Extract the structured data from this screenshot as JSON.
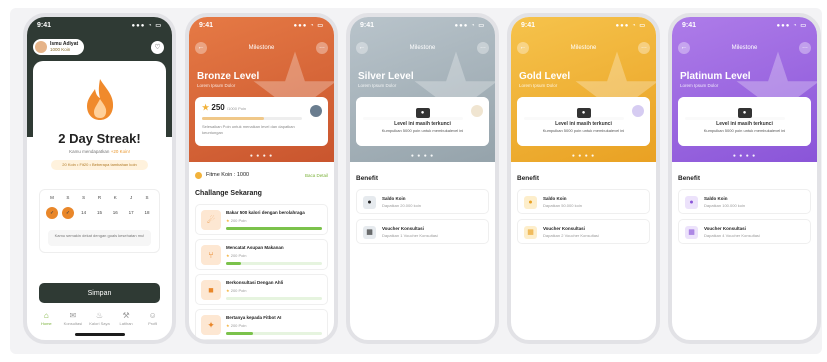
{
  "colors": {
    "bronze": "#d9653a",
    "silver": "#a8b5bd",
    "gold": "#f0b63a",
    "platinum": "#9a63e0",
    "green": "#7bb23a",
    "dark": "#2f3a34"
  },
  "status": {
    "time": "9:41",
    "signal": "●●● ◔ ▭"
  },
  "streak": {
    "user_name": "Ismu Adiyat",
    "user_coins": "1000 Koin",
    "bell_icon": "bell-icon",
    "title": "2 Day Streak!",
    "subtitle_prefix": "Kamu mendapatkan ",
    "subtitle_coins": "+20 Koin!",
    "pill_text": "20 Koin • Fit20 • Beberapa tambahan koin",
    "day_labels": [
      "M",
      "S",
      "S",
      "R",
      "K",
      "J",
      "S"
    ],
    "day_dates": [
      "",
      "",
      "14",
      "15",
      "16",
      "17",
      "18"
    ],
    "done_marks": [
      "✓",
      "✓"
    ],
    "note": "Kamu semakin dekat dengan goals kesehatan mu!",
    "save_label": "Simpan",
    "nav": [
      {
        "label": "Home",
        "icon": "home-icon",
        "glyph": "⌂"
      },
      {
        "label": "Konsultasi",
        "icon": "chat-icon",
        "glyph": "✉"
      },
      {
        "label": "Kalori Saya",
        "icon": "flame-icon",
        "glyph": "♨"
      },
      {
        "label": "Latihan",
        "icon": "dumbbell-icon",
        "glyph": "⚒"
      },
      {
        "label": "Profil",
        "icon": "user-icon",
        "glyph": "☺"
      }
    ]
  },
  "milestone_title": "Milestone",
  "bronze": {
    "level": "Bronze Level",
    "sub": "Lorem Ipsum Dolor",
    "points": "250",
    "points_max": "/1000 Poin",
    "card_text": "Selesaikan Poin untuk menaikan level dan dapatkan keuntungan",
    "dots": "● ● ● ●",
    "fitme": "Fitme Koin : 1000",
    "fitme_link": "Baca Detail",
    "challenges_title": "Challange Sekarang",
    "challenges": [
      {
        "title": "Bakar 500 kalori dengan berolahraga",
        "points": "200 Poin",
        "progress": 1.0,
        "icon": "run-icon",
        "glyph": "☄"
      },
      {
        "title": "Mencatat Asupan Makanan",
        "points": "200 Poin",
        "progress": 0.16,
        "icon": "fork-icon",
        "glyph": "⑂"
      },
      {
        "title": "Berkonsultasi Dengan Ahli",
        "points": "200 Poin",
        "progress": 0.0,
        "icon": "chat-bubble-icon",
        "glyph": "■"
      },
      {
        "title": "Bertanya kepada Fitbot AI",
        "points": "200 Poin",
        "progress": 0.28,
        "icon": "sparkle-icon",
        "glyph": "✦"
      }
    ]
  },
  "locked": {
    "text": "Level ini masih terkunci",
    "sub": "Kumpulkan 5000 poin untuk membukalevel ini"
  },
  "tiers": [
    {
      "key": "silver",
      "level": "Silver Level",
      "sub": "Lorem Ipsum Dolor",
      "benefit": "Benefit",
      "b1_title": "Saldo Koin",
      "b1_desc": "Dapatkan 20.000 koin",
      "b2_title": "Voucher Konsultasi",
      "b2_desc": "Dapatkan 1 Voucher Konsultasi"
    },
    {
      "key": "gold",
      "level": "Gold Level",
      "sub": "Lorem Ipsum Dolor",
      "benefit": "Benefit",
      "b1_title": "Saldo Koin",
      "b1_desc": "Dapatkan 50.000 koin",
      "b2_title": "Voucher Konsultasi",
      "b2_desc": "Dapatkan 2 Voucher Konsultasi"
    },
    {
      "key": "platinum",
      "level": "Platinum Level",
      "sub": "Lorem Ipsum Dolor",
      "benefit": "Benefit",
      "b1_title": "Saldo Koin",
      "b1_desc": "Dapatkan 100.000 koin",
      "b2_title": "Voucher Konsultasi",
      "b2_desc": "Dapatkan 4 Voucher Konsultasi"
    }
  ]
}
